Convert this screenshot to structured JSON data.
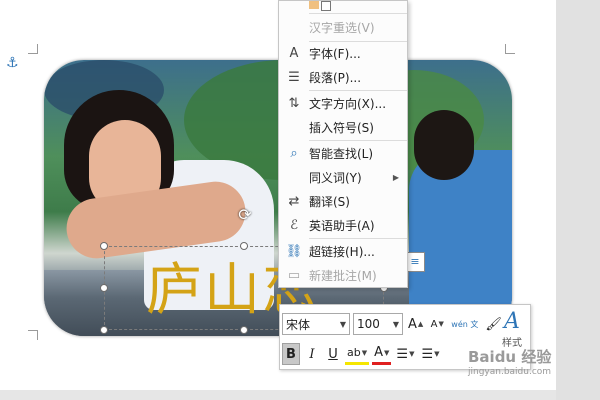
{
  "context_menu": {
    "items": [
      {
        "icon": "hanzi-reconvert-icon",
        "label": "汉字重选(V)",
        "disabled": true
      },
      {
        "icon": "font-icon",
        "icon_glyph": "A",
        "label": "字体(F)...",
        "disabled": false
      },
      {
        "icon": "paragraph-icon",
        "icon_glyph": "☰",
        "label": "段落(P)...",
        "disabled": false
      },
      {
        "icon": "text-direction-icon",
        "icon_glyph": "⇅",
        "label": "文字方向(X)...",
        "disabled": false
      },
      {
        "icon": "insert-symbol-icon",
        "icon_glyph": "",
        "label": "插入符号(S)",
        "disabled": false
      },
      {
        "icon": "smart-lookup-icon",
        "icon_glyph": "⌕",
        "label": "智能查找(L)",
        "disabled": false
      },
      {
        "icon": "synonyms-icon",
        "icon_glyph": "",
        "label": "同义词(Y)",
        "disabled": false,
        "has_submenu": true
      },
      {
        "icon": "translate-icon",
        "icon_glyph": "⇄",
        "label": "翻译(S)",
        "disabled": false
      },
      {
        "icon": "english-assistant-icon",
        "icon_glyph": "ℰ",
        "label": "英语助手(A)",
        "disabled": false
      },
      {
        "icon": "hyperlink-icon",
        "icon_glyph": "⛓",
        "label": "超链接(H)...",
        "disabled": false
      },
      {
        "icon": "new-comment-icon",
        "icon_glyph": "▭",
        "label": "新建批注(M)",
        "disabled": true
      }
    ]
  },
  "document": {
    "title_text": "庐山恋"
  },
  "mini_toolbar": {
    "font_name": "宋体",
    "font_size": "100",
    "grow_font": "A",
    "shrink_font": "A",
    "phonetic_guide": "wén 文",
    "format_painter": "🖌",
    "bold": "B",
    "italic": "I",
    "underline": "U",
    "highlight": "ab",
    "font_color": "A",
    "bullets": "☰",
    "numbering": "☰",
    "styles_glyph": "A",
    "styles_label": "样式"
  },
  "watermark": {
    "main": "Baidu 经验",
    "sub": "jingyan.baidu.com"
  },
  "colors": {
    "title_gold": "#d4a316",
    "accent_blue": "#2e75b6"
  }
}
